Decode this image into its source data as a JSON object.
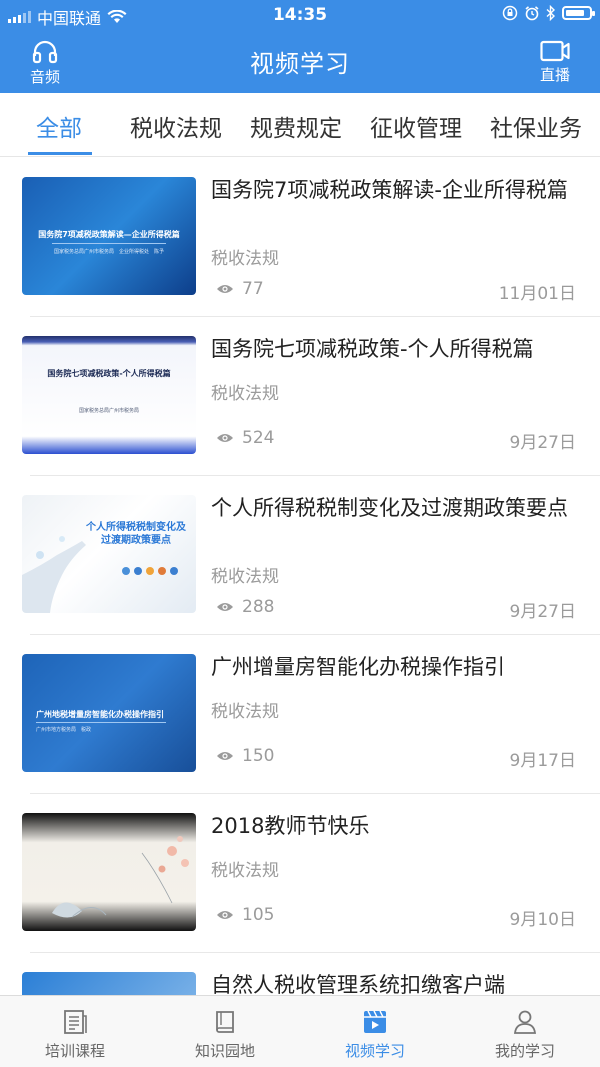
{
  "status_bar": {
    "carrier": "中国联通",
    "time": "14:35"
  },
  "header": {
    "title": "视频学习",
    "left_button_label": "音频",
    "right_button_label": "直播",
    "background_color": "#3b8de6"
  },
  "tabs": [
    {
      "label": "全部",
      "active": true
    },
    {
      "label": "税收法规",
      "active": false
    },
    {
      "label": "规费规定",
      "active": false
    },
    {
      "label": "征收管理",
      "active": false
    },
    {
      "label": "社保业务",
      "active": false
    }
  ],
  "videos": [
    {
      "title": "国务院7项减税政策解读-企业所得税篇",
      "category": "税收法规",
      "views": "77",
      "date": "11月01日",
      "thumb_text": "国务院7项减税政策解读—企业所得税篇",
      "thumb_sub": "国家税务总局广州市税务局　企业所得税处　陈予"
    },
    {
      "title": "国务院七项减税政策-个人所得税篇",
      "category": "税收法规",
      "views": "524",
      "date": "9月27日",
      "thumb_text": "国务院七项减税政策-个人所得税篇",
      "thumb_sub": "国家税务总局广州市税务局"
    },
    {
      "title": "个人所得税税制变化及过渡期政策要点",
      "category": "税收法规",
      "views": "288",
      "date": "9月27日",
      "thumb_text": "个人所得税税制变化及过渡期政策要点"
    },
    {
      "title": "广州增量房智能化办税操作指引",
      "category": "税收法规",
      "views": "150",
      "date": "9月17日",
      "thumb_text": "广州地税增量房智能化办税操作指引",
      "thumb_sub": "广州市地方税务局　税政"
    },
    {
      "title": "2018教师节快乐",
      "category": "税收法规",
      "views": "105",
      "date": "9月10日"
    },
    {
      "title": "自然人税收管理系统扣缴客户端",
      "category": "",
      "views": "",
      "date": ""
    }
  ],
  "bottom_tabs": [
    {
      "label": "培训课程",
      "icon": "document-icon",
      "active": false
    },
    {
      "label": "知识园地",
      "icon": "book-icon",
      "active": false
    },
    {
      "label": "视频学习",
      "icon": "film-icon",
      "active": true
    },
    {
      "label": "我的学习",
      "icon": "person-icon",
      "active": false
    }
  ]
}
